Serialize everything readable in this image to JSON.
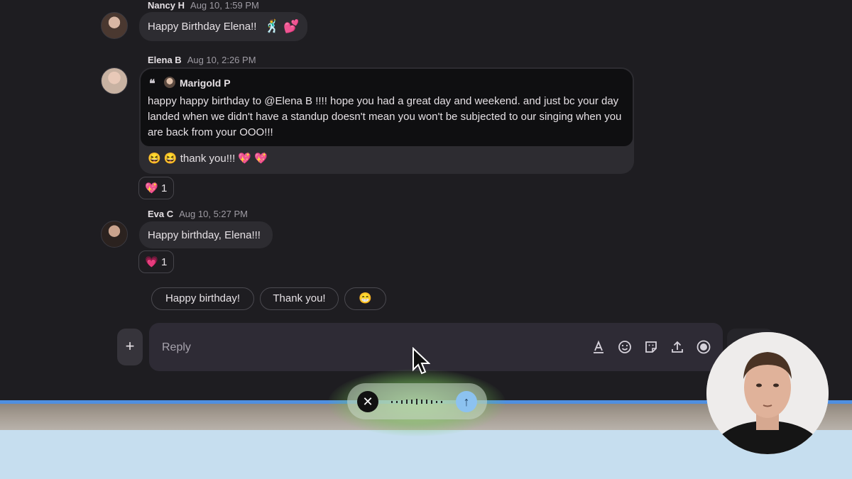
{
  "messages": [
    {
      "author": "Nancy H",
      "time": "Aug 10, 1:59 PM",
      "text": "Happy Birthday Elena!!",
      "emojis": "🕺 💕"
    },
    {
      "author": "Elena B",
      "time": "Aug 10, 2:26 PM",
      "quote": {
        "author": "Marigold P",
        "text": "happy happy birthday to @Elena B !!!! hope you had a great day and weekend. and just bc your day landed when we didn't have a standup doesn't mean you won't be subjected to our singing when you are back from your OOO!!!"
      },
      "text": "😆 😆 thank you!!! 💖 💖",
      "reaction": {
        "emoji": "💖",
        "count": "1"
      }
    },
    {
      "author": "Eva C",
      "time": "Aug 10, 5:27 PM",
      "text": "Happy birthday, Elena!!!",
      "reaction": {
        "emoji": "💗",
        "count": "1"
      }
    }
  ],
  "smart_replies": [
    "Happy birthday!",
    "Thank you!",
    "😁"
  ],
  "composer": {
    "plus": "+",
    "placeholder": "Reply"
  },
  "icons": {
    "quote": "quote-icon",
    "format": "text-format-icon",
    "emoji": "emoji-icon",
    "sticker": "sticker-icon",
    "upload": "upload-icon",
    "record": "record-icon",
    "close": "close-icon",
    "send": "send-arrow-icon",
    "cursor": "mouse-cursor-icon"
  },
  "colors": {
    "accent": "#4f8fe0",
    "glow": "#96e678",
    "send": "#8cc2f0"
  }
}
